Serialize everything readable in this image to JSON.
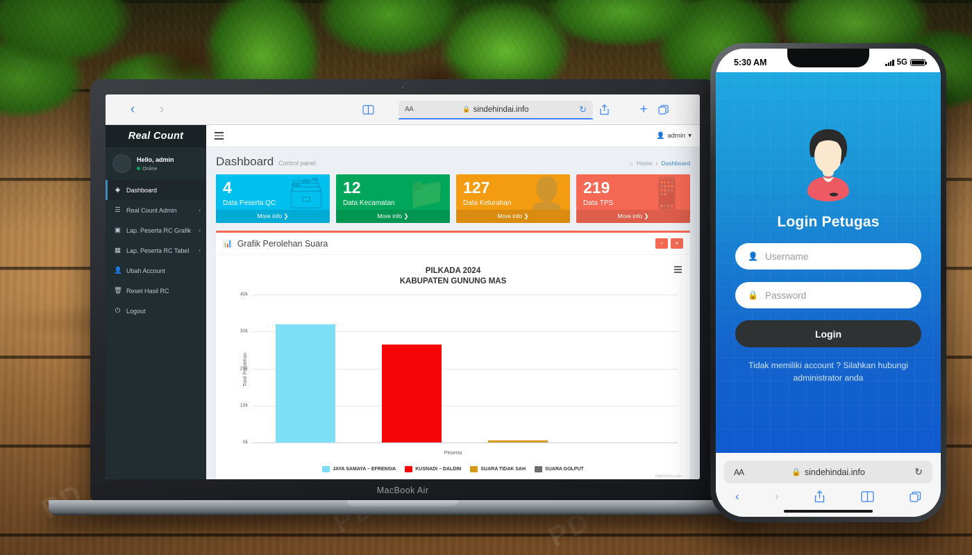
{
  "background": {
    "scene": "green-leaves-over-wooden-table"
  },
  "laptop": {
    "model_label": "MacBook Air",
    "browser": {
      "back_icon": "‹",
      "forward_icon": "›",
      "sidebar_icon": "book-icon",
      "aa_label": "AA",
      "lock_icon": "🔒",
      "url": "sindehindai.info",
      "reload_icon": "↻",
      "share_icon": "share-icon",
      "new_tab_icon": "+",
      "tabs_icon": "tabs-icon"
    }
  },
  "dashboard": {
    "sidebar": {
      "brand": "Real Count",
      "user": {
        "greeting": "Hello, admin",
        "status": "Online"
      },
      "items": [
        {
          "label": "Dashboard",
          "icon": "dashboard-icon",
          "active": true,
          "caret": false
        },
        {
          "label": "Real Count Admin",
          "icon": "list-icon",
          "active": false,
          "caret": true
        },
        {
          "label": "Lap. Peserta RC Grafik",
          "icon": "image-icon",
          "active": false,
          "caret": true
        },
        {
          "label": "Lap. Peserta RC Tabel",
          "icon": "table-icon",
          "active": false,
          "caret": true
        },
        {
          "label": "Ubah Account",
          "icon": "user-icon",
          "active": false,
          "caret": false
        },
        {
          "label": "Reset Hasil RC",
          "icon": "trash-icon",
          "active": false,
          "caret": false
        },
        {
          "label": "Logout",
          "icon": "power-icon",
          "active": false,
          "caret": false
        }
      ]
    },
    "navbar": {
      "menu_toggle": "hamburger-icon",
      "user": "admin",
      "caret": "▾"
    },
    "header": {
      "title": "Dashboard",
      "subtitle": "Control panel",
      "breadcrumb": {
        "home": "Home",
        "separator": "›",
        "current": "Dashboard"
      }
    },
    "cards": [
      {
        "number": "4",
        "label": "Data Peserta QC",
        "more": "More info",
        "color": "#00c0ef",
        "icon": "inbox-icon"
      },
      {
        "number": "12",
        "label": "Data Kecamatan",
        "more": "More info",
        "color": "#00a65a",
        "icon": "folder-icon"
      },
      {
        "number": "127",
        "label": "Data Kelurahan",
        "more": "More info",
        "color": "#f39c12",
        "icon": "user-add-icon"
      },
      {
        "number": "219",
        "label": "Data TPS",
        "more": "More info",
        "color": "#f56954",
        "icon": "phone-icon"
      }
    ],
    "box": {
      "title": "Grafik Perolehan Suara",
      "icon": "bar-chart-icon",
      "collapse_label": "−",
      "close_label": "×",
      "accent_color": "#f56954"
    }
  },
  "chart_data": {
    "type": "bar",
    "title": "PILKADA 2024",
    "subtitle": "KABUPATEN GUNUNG MAS",
    "xlabel": "Peserta",
    "ylabel": "Total Perolehan",
    "categories": [
      "JAYA SAMAYA – EFRENSIA",
      "KUSNADI – DALDIN",
      "SUARA TIDAK SAH",
      "SUARA GOLPUT"
    ],
    "values": [
      32000,
      26500,
      600,
      0
    ],
    "colors": [
      "#7ddef5",
      "#f50505",
      "#d4981a",
      "#666666"
    ],
    "ylim": [
      0,
      40000
    ],
    "yticks": [
      0,
      10000,
      20000,
      30000,
      40000
    ],
    "ytick_labels": [
      "0k",
      "10k",
      "20k",
      "30k",
      "40k"
    ],
    "grid": true,
    "legend_position": "bottom",
    "credit": "Highcharts.com",
    "menu_icon": "chart-menu-icon"
  },
  "phone": {
    "status": {
      "time": "5:30 AM",
      "network": "5G",
      "signal_icon": "signal-icon",
      "battery_icon": "battery-icon"
    },
    "login": {
      "avatar_icon": "user-avatar-illustration",
      "title": "Login Petugas",
      "username_placeholder": "Username",
      "username_value": "",
      "username_icon": "user-icon",
      "password_placeholder": "Password",
      "password_value": "",
      "password_icon": "lock-icon",
      "submit_label": "Login",
      "note": "Tidak memiliki account ? Silahkan hubungi administrator anda"
    },
    "browser": {
      "aa_label": "AA",
      "lock_icon": "🔒",
      "url": "sindehindai.info",
      "reload_icon": "↻",
      "back_icon": "‹",
      "forward_icon": "›",
      "share_icon": "share-icon",
      "book_icon": "book-icon",
      "tabs_icon": "tabs-icon"
    }
  }
}
